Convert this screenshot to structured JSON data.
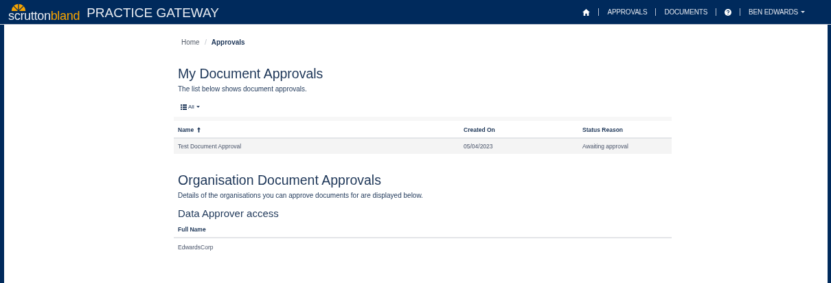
{
  "header": {
    "brand_left": "scrutton",
    "brand_right": "bland",
    "title": "PRACTICE GATEWAY",
    "nav": [
      {
        "kind": "home"
      },
      {
        "kind": "link",
        "label": "APPROVALS"
      },
      {
        "kind": "link",
        "label": "DOCUMENTS"
      },
      {
        "kind": "help"
      },
      {
        "kind": "user",
        "label": "BEN EDWARDS"
      }
    ]
  },
  "breadcrumb": [
    {
      "label": "Home",
      "selected": false
    },
    {
      "label": "Approvals",
      "selected": true
    }
  ],
  "my_approvals": {
    "title": "My Document Approvals",
    "description": "The list below shows document approvals.",
    "filter": "All",
    "columns": [
      {
        "label": "Name",
        "sorted": true
      },
      {
        "label": "Created On",
        "sorted": false
      },
      {
        "label": "Status Reason",
        "sorted": false
      }
    ],
    "rows": [
      [
        "Test Document Approval",
        "05/04/2023",
        "Awaiting approval"
      ]
    ]
  },
  "org_approvals": {
    "title": "Organisation Document Approvals",
    "description": "Details of the organisations you can approve documents for are displayed below.",
    "subtitle": "Data Approver access",
    "columns": [
      {
        "label": "Full Name",
        "sorted": false
      }
    ],
    "rows": [
      [
        "EdwardsCorp"
      ]
    ]
  }
}
